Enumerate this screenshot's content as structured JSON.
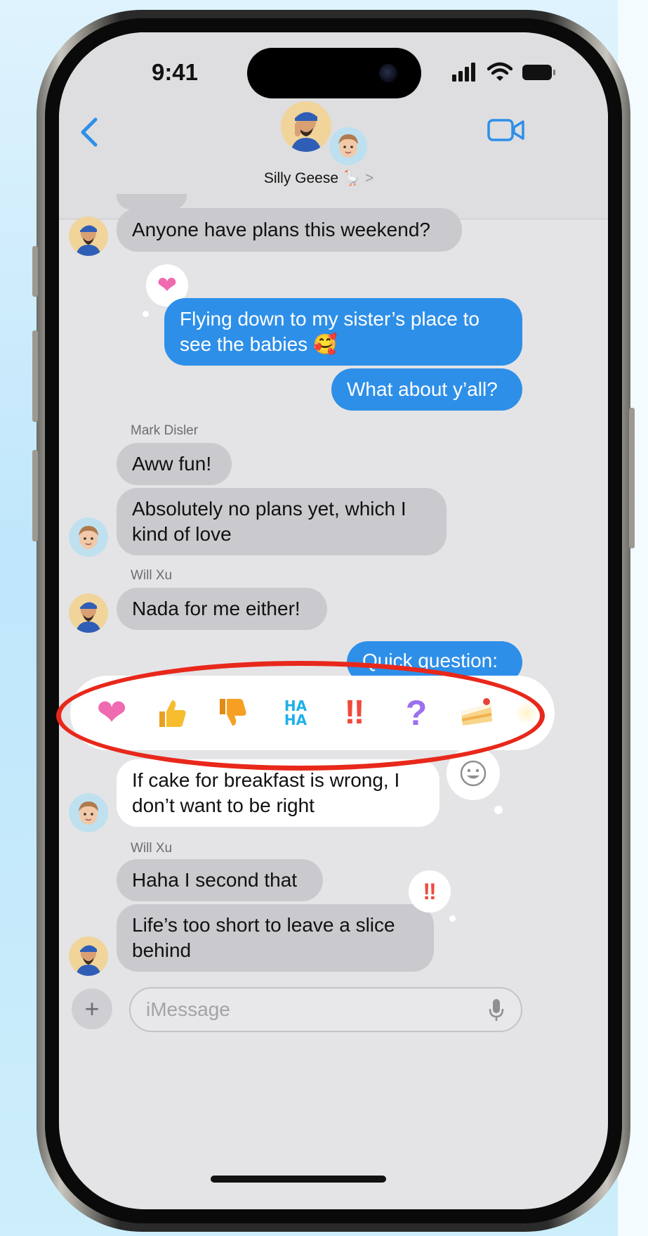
{
  "status_bar": {
    "time": "9:41"
  },
  "header": {
    "group_name": "Silly Geese",
    "group_emoji": "🪿",
    "chevron": ">",
    "back_icon": "chevron-left-icon",
    "video_icon": "video-camera-icon"
  },
  "messages": [
    {
      "text": "Anyone have plans this weekend?",
      "side": "received",
      "sender": ""
    },
    {
      "text": "Flying down to my sister’s place to see the babies 🥰",
      "side": "sent",
      "tapback": "heart"
    },
    {
      "text": "What about y’all?",
      "side": "sent"
    },
    {
      "text": "Aww fun!",
      "side": "received",
      "sender": "Mark Disler"
    },
    {
      "text": "Absolutely no plans yet, which I kind of love",
      "side": "received",
      "sender": "Mark Disler"
    },
    {
      "text": "Nada for me either!",
      "side": "received",
      "sender": "Will Xu"
    },
    {
      "text": "Quick question:",
      "side": "sent"
    },
    {
      "text": "If cake for breakfast is wrong, I don’t want to be right",
      "side": "received",
      "highlighted": true
    },
    {
      "text": "Haha I second that",
      "side": "received",
      "sender": "Will Xu"
    },
    {
      "text": "Life’s too short to leave a slice behind",
      "side": "received",
      "sender": "Will Xu",
      "tapback": "exclamation"
    }
  ],
  "labels": {
    "msg1": "Anyone have plans this weekend?",
    "msg2_line1": "Flying down to my sister’s place to",
    "msg2_line2": "see the babies 🥰",
    "msg3": "What about y’all?",
    "sender_mark": "Mark Disler",
    "msg4": "Aww fun!",
    "msg5_line1": "Absolutely no plans yet, which I",
    "msg5_line2": "kind of love",
    "sender_will_1": "Will Xu",
    "msg6": "Nada for me either!",
    "msg7": "Quick question:",
    "msg8_line1": "If cake for breakfast is wrong, I",
    "msg8_line2": "don’t want to be right",
    "sender_will_2": "Will Xu",
    "msg9": "Haha I second that",
    "msg10_line1": "Life’s too short to leave a slice",
    "msg10_line2": "behind"
  },
  "tapbacks": [
    {
      "name": "heart",
      "glyph": "❤",
      "color": "#f06ab0"
    },
    {
      "name": "thumbs-up",
      "glyph": "👍",
      "color": "#f5b425"
    },
    {
      "name": "thumbs-down",
      "glyph": "👎",
      "color": "#f5a023"
    },
    {
      "name": "haha",
      "glyph": "HA HA",
      "color": "#1fb0e8"
    },
    {
      "name": "exclamation",
      "glyph": "‼",
      "color": "#f04a3a"
    },
    {
      "name": "question",
      "glyph": "?",
      "color": "#9b6ff0"
    },
    {
      "name": "cake",
      "glyph": "🍰",
      "color": "#f5c46b"
    }
  ],
  "composer": {
    "placeholder": "iMessage",
    "plus": "+",
    "mic_icon": "microphone-icon"
  },
  "colors": {
    "accent_blue": "#2e8fe8",
    "received_gray": "#c9c9ce",
    "highlight_ring": "#e8281b"
  }
}
